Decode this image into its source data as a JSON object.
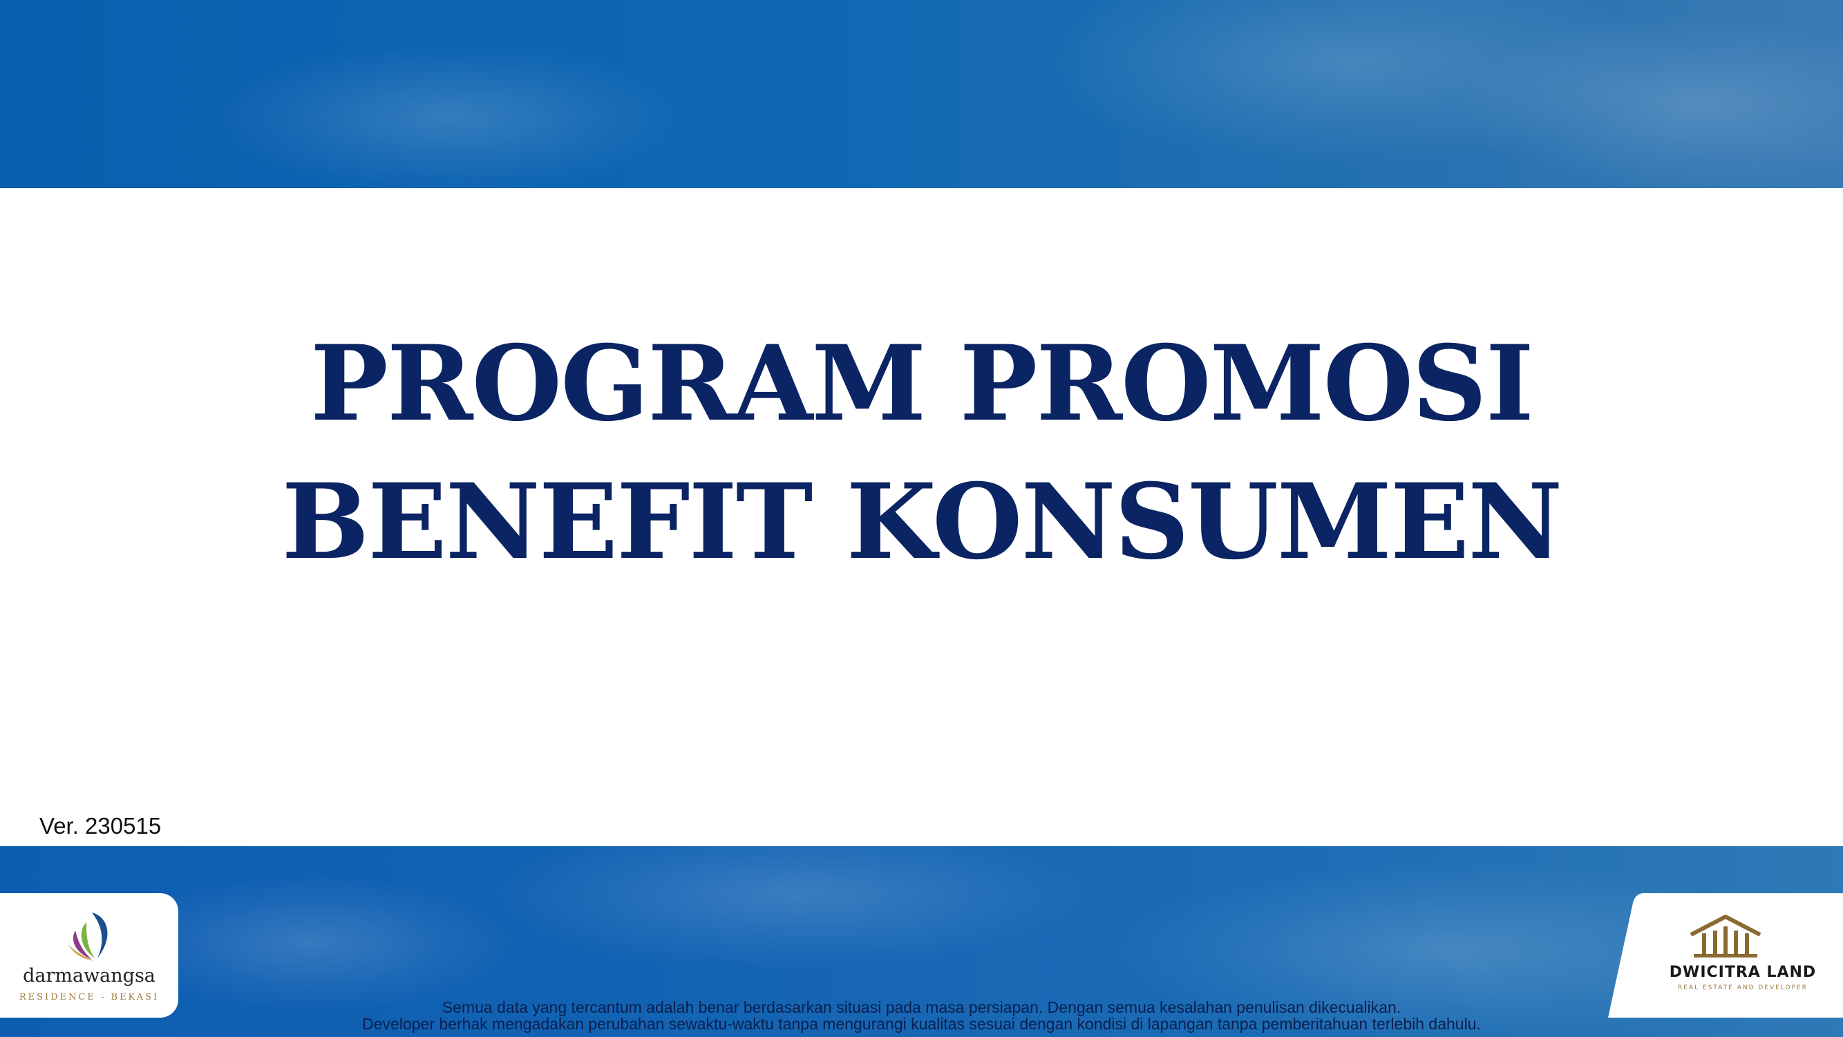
{
  "slide": {
    "title_line1": "PROGRAM PROMOSI",
    "title_line2": "BENEFIT KONSUMEN",
    "version": "Ver. 230515"
  },
  "logos": {
    "left": {
      "name": "darmawangsa",
      "subtitle": "RESIDENCE - BEKASI",
      "icon": "leaf-logo-icon"
    },
    "right": {
      "name": "DWICITRA LAND",
      "subtitle": "REAL ESTATE AND DEVELOPER",
      "icon": "house-logo-icon"
    }
  },
  "footer": {
    "disclaimer_line1": "Semua data yang tercantum adalah benar berdasarkan situasi pada masa persiapan. Dengan semua kesalahan penulisan dikecualikan.",
    "disclaimer_line2": "Developer berhak mengadakan perubahan sewaktu-waktu tanpa mengurangi kualitas sesuai dengan kondisi di lapangan tanpa pemberitahuan terlebih dahulu."
  },
  "colors": {
    "title": "#0b2463",
    "band": "#0a5fae",
    "accent_gold": "#9a7a3d"
  }
}
